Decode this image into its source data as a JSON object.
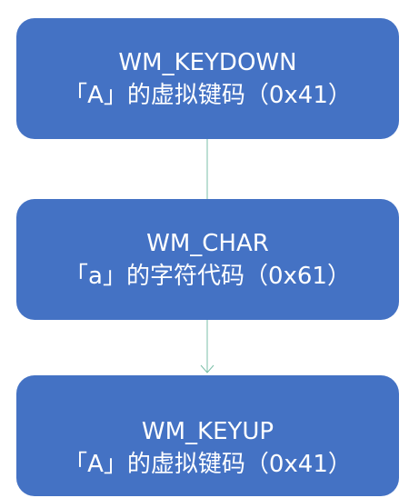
{
  "colors": {
    "box_fill": "#4472C4",
    "text": "#FFFFFF",
    "connector": "#7BBFA8"
  },
  "nodes": [
    {
      "line1": "WM_KEYDOWN",
      "line2": "「A」的虚拟键码（0x41）"
    },
    {
      "line1": "WM_CHAR",
      "line2": "「a」的字符代码（0x61）"
    },
    {
      "line1": "WM_KEYUP",
      "line2": "「A」的虚拟键码（0x41）"
    }
  ]
}
